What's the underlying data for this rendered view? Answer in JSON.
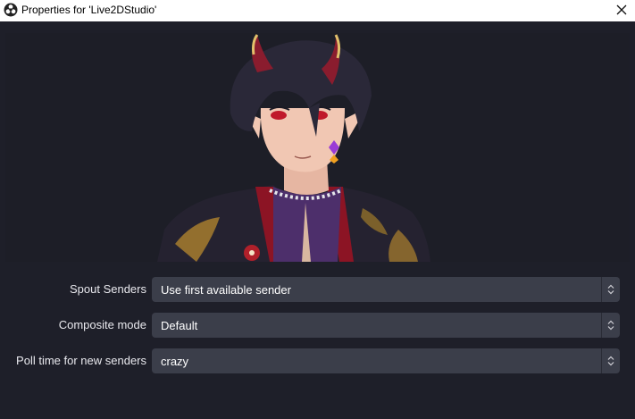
{
  "window": {
    "title": "Properties for 'Live2DStudio'",
    "app_icon": "obs-icon",
    "close_icon": "close-icon"
  },
  "preview": {
    "description_icon": "character-preview-image"
  },
  "fields": [
    {
      "label": "Spout Senders",
      "value": "Use first available sender"
    },
    {
      "label": "Composite mode",
      "value": "Default"
    },
    {
      "label": "Poll time for new senders",
      "value": "crazy"
    }
  ],
  "colors": {
    "background": "#1e1f29",
    "select_bg": "#3b3e4a",
    "titlebar_bg": "#ffffff"
  }
}
